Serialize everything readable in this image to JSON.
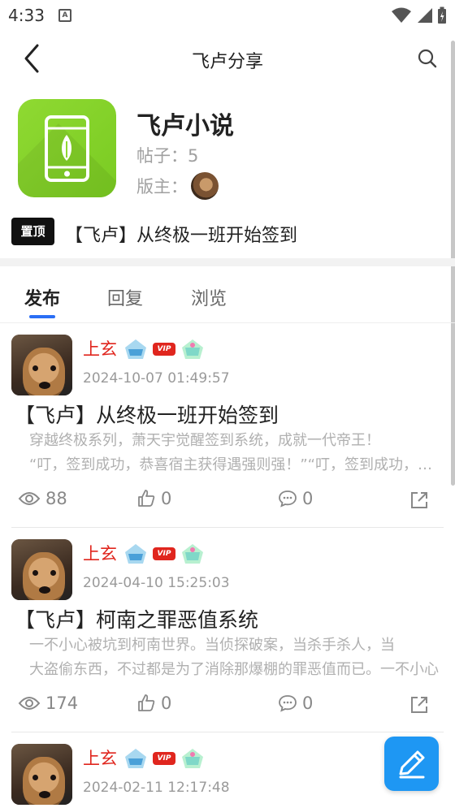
{
  "status": {
    "time": "4:33",
    "notif_glyph": "A"
  },
  "header": {
    "title": "飞卢分享",
    "back_icon": "chevron-left-icon",
    "search_icon": "search-icon"
  },
  "forum": {
    "name": "飞卢小说",
    "posts_label": "帖子：",
    "posts_count": "5",
    "moderator_label": "版主：",
    "icon_color": "#8fd932"
  },
  "pinned": {
    "badge": "置顶",
    "title": "【飞卢】从终极一班开始签到"
  },
  "tabs": [
    {
      "label": "发布",
      "active": true
    },
    {
      "label": "回复",
      "active": false
    },
    {
      "label": "浏览",
      "active": false
    }
  ],
  "posts": [
    {
      "author": "上玄",
      "vip_label": "VIP",
      "date": "2024-10-07 01:49:57",
      "title": "【飞卢】从终极一班开始签到",
      "excerpt_line1": "穿越终极系列，萧天宇觉醒签到系统，成就一代帝王！",
      "excerpt_line2": "“叮，签到成功，恭喜宿主获得遇强则强！”“叮，签到成功，恭喜宿主获得",
      "views": "88",
      "likes": "0",
      "comments": "0"
    },
    {
      "author": "上玄",
      "vip_label": "VIP",
      "date": "2024-04-10 15:25:03",
      "title": "【飞卢】柯南之罪恶值系统",
      "excerpt_line1": "一不小心被坑到柯南世界。当侦探破案，当杀手杀人，当",
      "excerpt_line2": "大盗偷东西，不过都是为了消除那爆棚的罪恶值而已。一不小心",
      "views": "174",
      "likes": "0",
      "comments": "0"
    },
    {
      "author": "上玄",
      "vip_label": "VIP",
      "date": "2024-02-11 12:17:48"
    }
  ],
  "colors": {
    "accent": "#2a6ef5",
    "author_red": "#e0261e",
    "fab_blue": "#1e97f3"
  }
}
